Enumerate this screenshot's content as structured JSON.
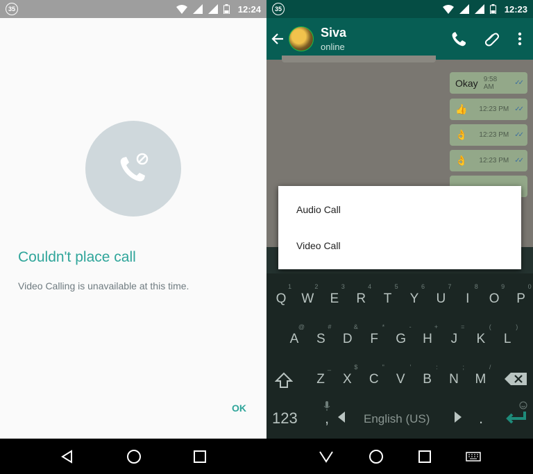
{
  "left": {
    "status": {
      "badge": "35",
      "time": "12:24"
    },
    "dialog": {
      "title": "Couldn't place call",
      "message": "Video Calling is unavailable at this time.",
      "ok_label": "OK"
    }
  },
  "right": {
    "status": {
      "badge": "35",
      "time": "12:23"
    },
    "contact": {
      "name": "Siva",
      "status": "online"
    },
    "messages": [
      {
        "text": "Okay",
        "time": "9:58 AM"
      },
      {
        "text": "👍",
        "time": "12:23 PM"
      },
      {
        "text": "👌",
        "time": "12:23 PM"
      },
      {
        "text": "👌",
        "time": "12:23 PM"
      }
    ],
    "menu": {
      "audio_call": "Audio Call",
      "video_call": "Video Call"
    },
    "keyboard": {
      "row1": [
        "Q",
        "W",
        "E",
        "R",
        "T",
        "Y",
        "U",
        "I",
        "O",
        "P"
      ],
      "row1_hints": [
        "1",
        "2",
        "3",
        "4",
        "5",
        "6",
        "7",
        "8",
        "9",
        "0"
      ],
      "row2": [
        "A",
        "S",
        "D",
        "F",
        "G",
        "H",
        "J",
        "K",
        "L"
      ],
      "row2_hints": [
        "@",
        "#",
        "&",
        "*",
        "-",
        "+",
        "=",
        "(",
        ")"
      ],
      "row3": [
        "Z",
        "X",
        "C",
        "V",
        "B",
        "N",
        "M"
      ],
      "row3_hints": [
        "_",
        "$",
        "\"",
        "'",
        ":",
        ";",
        "/"
      ],
      "mode_key": "123",
      "comma": ",",
      "space_label": "English (US)",
      "period": "."
    }
  },
  "colors": {
    "accent": "#2fa59a",
    "whatsapp_dark": "#054d44",
    "whatsapp_bar": "#075e54"
  }
}
